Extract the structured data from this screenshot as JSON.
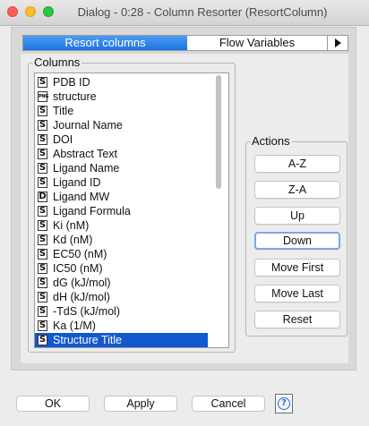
{
  "window": {
    "title": "Dialog - 0:28 - Column Resorter (ResortColumn)"
  },
  "tabs": [
    {
      "label": "Resort columns",
      "active": true
    },
    {
      "label": "Flow Variables",
      "active": false
    }
  ],
  "tab_overflow_icon": "right-triangle-arrow",
  "columns_group": {
    "label": "Columns",
    "items": [
      {
        "type": "S",
        "label": "PDB ID"
      },
      {
        "type": "PNG",
        "label": "structure"
      },
      {
        "type": "S",
        "label": "Title"
      },
      {
        "type": "S",
        "label": "Journal Name"
      },
      {
        "type": "S",
        "label": "DOI"
      },
      {
        "type": "S",
        "label": "Abstract Text"
      },
      {
        "type": "S",
        "label": "Ligand Name"
      },
      {
        "type": "S",
        "label": "Ligand ID"
      },
      {
        "type": "D",
        "label": "Ligand MW"
      },
      {
        "type": "S",
        "label": "Ligand Formula"
      },
      {
        "type": "S",
        "label": "Ki (nM)"
      },
      {
        "type": "S",
        "label": "Kd (nM)"
      },
      {
        "type": "S",
        "label": "EC50 (nM)"
      },
      {
        "type": "S",
        "label": "IC50 (nM)"
      },
      {
        "type": "S",
        "label": "dG (kJ/mol)"
      },
      {
        "type": "S",
        "label": "dH (kJ/mol)"
      },
      {
        "type": "S",
        "label": "-TdS (kJ/mol)"
      },
      {
        "type": "S",
        "label": "Ka (1/M)"
      },
      {
        "type": "S",
        "label": "Structure Title",
        "selected": true
      }
    ]
  },
  "actions_group": {
    "label": "Actions",
    "buttons": [
      "A-Z",
      "Z-A",
      "Up",
      "Down",
      "Move First",
      "Move Last",
      "Reset"
    ],
    "focused": "Down"
  },
  "footer": {
    "ok": "OK",
    "apply": "Apply",
    "cancel": "Cancel",
    "help": "?"
  },
  "colors": {
    "tab_active": "#1f73e0",
    "selection": "#1458d0",
    "focus_ring": "#7aa8e6",
    "close": "#fc5f57",
    "minimize": "#fdbc2e",
    "maximize": "#28c840"
  }
}
